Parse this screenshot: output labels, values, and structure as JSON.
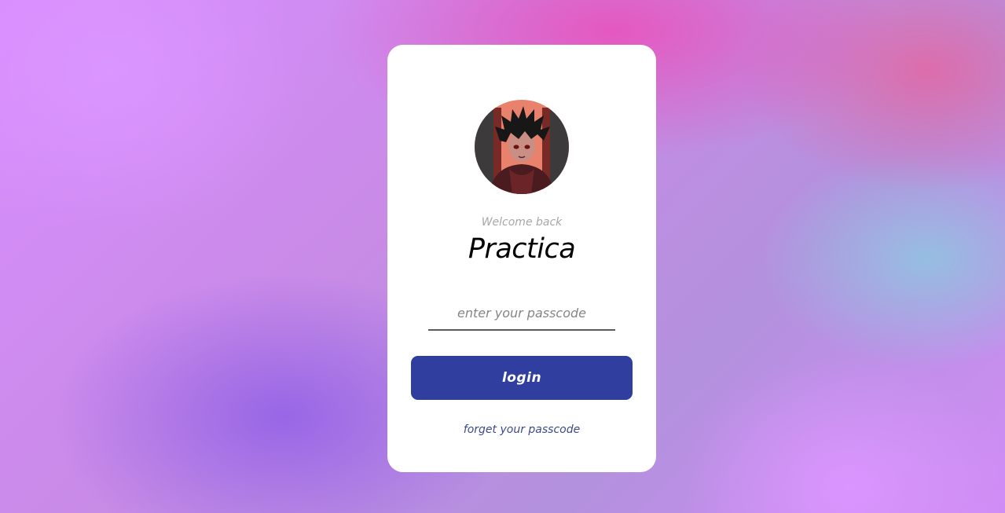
{
  "login": {
    "avatar_icon": "anime-avatar-icon",
    "welcome_text": "Welcome back",
    "title": "Practica",
    "passcode_placeholder": "enter your passcode",
    "passcode_value": "",
    "login_label": "login",
    "forget_label": "forget your passcode"
  },
  "colors": {
    "button": "#303f9f",
    "card": "#ffffff",
    "link": "#3a4a8a"
  }
}
